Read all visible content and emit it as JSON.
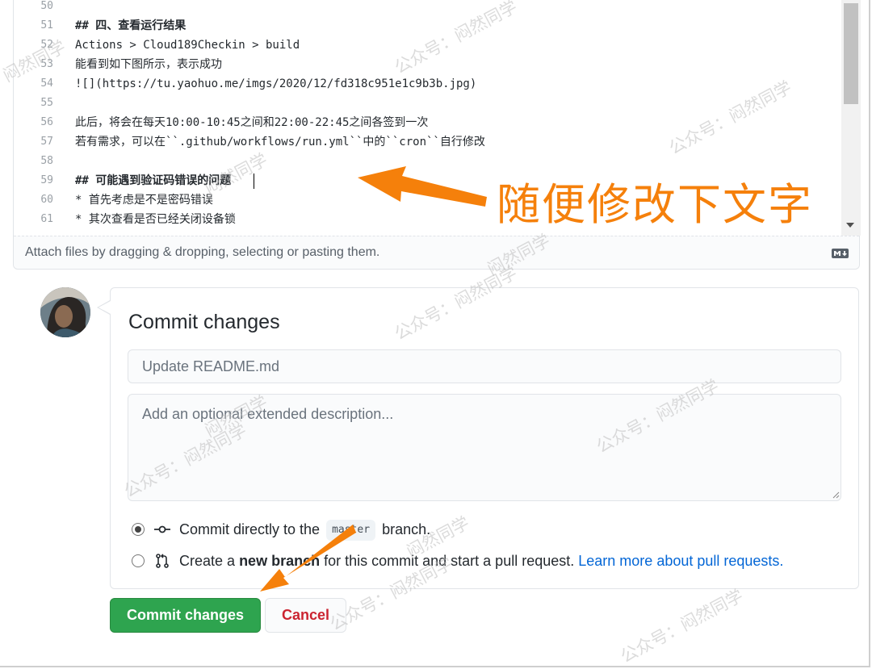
{
  "editor": {
    "lines": [
      {
        "n": "50",
        "text": "",
        "heading": false
      },
      {
        "n": "51",
        "text": "## 四、查看运行结果",
        "heading": true
      },
      {
        "n": "52",
        "text": "Actions > Cloud189Checkin > build",
        "heading": false
      },
      {
        "n": "53",
        "text": "能看到如下图所示，表示成功",
        "heading": false
      },
      {
        "n": "54",
        "text": "![](https://tu.yaohuo.me/imgs/2020/12/fd318c951e1c9b3b.jpg)",
        "heading": false
      },
      {
        "n": "55",
        "text": "",
        "heading": false
      },
      {
        "n": "56",
        "text": "此后，将会在每天10:00-10:45之间和22:00-22:45之间各签到一次",
        "heading": false
      },
      {
        "n": "57",
        "text": "若有需求，可以在``.github/workflows/run.yml``中的``cron``自行修改",
        "heading": false
      },
      {
        "n": "58",
        "text": "",
        "heading": false
      },
      {
        "n": "59",
        "text": "## 可能遇到验证码错误的问题",
        "heading": true
      },
      {
        "n": "60",
        "text": "* 首先考虑是不是密码错误",
        "heading": false
      },
      {
        "n": "61",
        "text": "* 其次查看是否已经关闭设备锁",
        "heading": false
      }
    ],
    "attach_hint": "Attach files by dragging & dropping, selecting or pasting them.",
    "markdown_icon": "markdown-icon"
  },
  "annotation": {
    "text": "随便修改下文字",
    "color": "#f5800b"
  },
  "commit": {
    "title": "Commit changes",
    "summary_placeholder": "Update README.md",
    "description_placeholder": "Add an optional extended description...",
    "option_direct": {
      "prefix": "Commit directly to the",
      "branch": "master",
      "suffix": "branch.",
      "checked": true,
      "icon": "git-commit-icon"
    },
    "option_new": {
      "prefix": "Create a",
      "bold": "new branch",
      "suffix": "for this commit and start a pull request.",
      "link": "Learn more about pull requests.",
      "checked": false,
      "icon": "git-pull-request-icon"
    },
    "submit_label": "Commit changes",
    "cancel_label": "Cancel"
  },
  "watermark": {
    "text": "公众号：闷然同学",
    "short": "闷然同学"
  },
  "colors": {
    "primary_button": "#2ea44f",
    "cancel_text": "#cb2431",
    "link": "#0366d6"
  }
}
